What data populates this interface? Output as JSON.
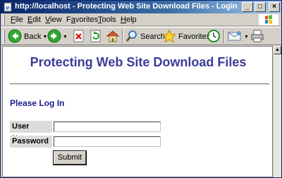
{
  "window": {
    "title": "http://localhost - Protecting Web Site Download Files - Login - Microsoft Internet Explorer",
    "controls": {
      "minimize": "_",
      "maximize": "□",
      "close": "×"
    }
  },
  "menu": [
    {
      "label": "File",
      "key": "F",
      "rest": "ile"
    },
    {
      "label": "Edit",
      "key": "E",
      "rest": "dit"
    },
    {
      "label": "View",
      "key": "V",
      "rest": "iew"
    },
    {
      "label": "Favorites",
      "key": "a",
      "pre": "F",
      "rest": "vorites"
    },
    {
      "label": "Tools",
      "key": "T",
      "rest": "ools"
    },
    {
      "label": "Help",
      "key": "H",
      "rest": "elp"
    }
  ],
  "toolbar": {
    "back_label": "Back",
    "search_label": "Search",
    "favorites_label": "Favorites"
  },
  "page": {
    "heading": "Protecting Web Site Download Files",
    "section_title": "Please Log In",
    "username_label": "User Name",
    "password_label": "Password",
    "username_value": "",
    "password_value": "",
    "submit_label": "Submit"
  },
  "colors": {
    "heading": "#3b3b98",
    "section_title": "#1a1a8c",
    "titlebar_start": "#0a246a",
    "titlebar_end": "#a6caf0"
  },
  "icons": [
    "ie-page-icon",
    "windows-flag-icon",
    "back-icon",
    "forward-icon",
    "stop-icon",
    "refresh-icon",
    "home-icon",
    "search-icon",
    "favorites-star-icon",
    "history-icon",
    "mail-icon",
    "print-icon"
  ]
}
